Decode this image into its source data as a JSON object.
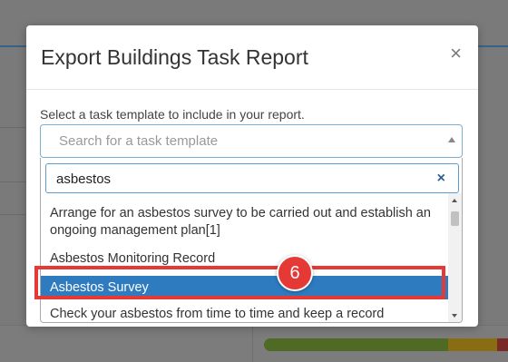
{
  "modal": {
    "title": "Export Buildings Task Report",
    "close_glyph": "×",
    "instruction": "Select a task template to include in your report.",
    "select_placeholder": "Search for a task template"
  },
  "search": {
    "value": "asbestos",
    "clear_glyph": "×"
  },
  "results": [
    {
      "label": "Arrange for an asbestos survey to be carried out and establish an ongoing management plan[1]"
    },
    {
      "label": "Asbestos Monitoring Record"
    },
    {
      "label": "Asbestos Survey",
      "highlighted": true
    },
    {
      "label": "Check your asbestos from time to time and keep a record"
    }
  ],
  "annotation": {
    "step": "6",
    "color": "#e53935"
  },
  "colors": {
    "accent": "#2f7bc0",
    "focus_border": "#5b9bd1"
  }
}
